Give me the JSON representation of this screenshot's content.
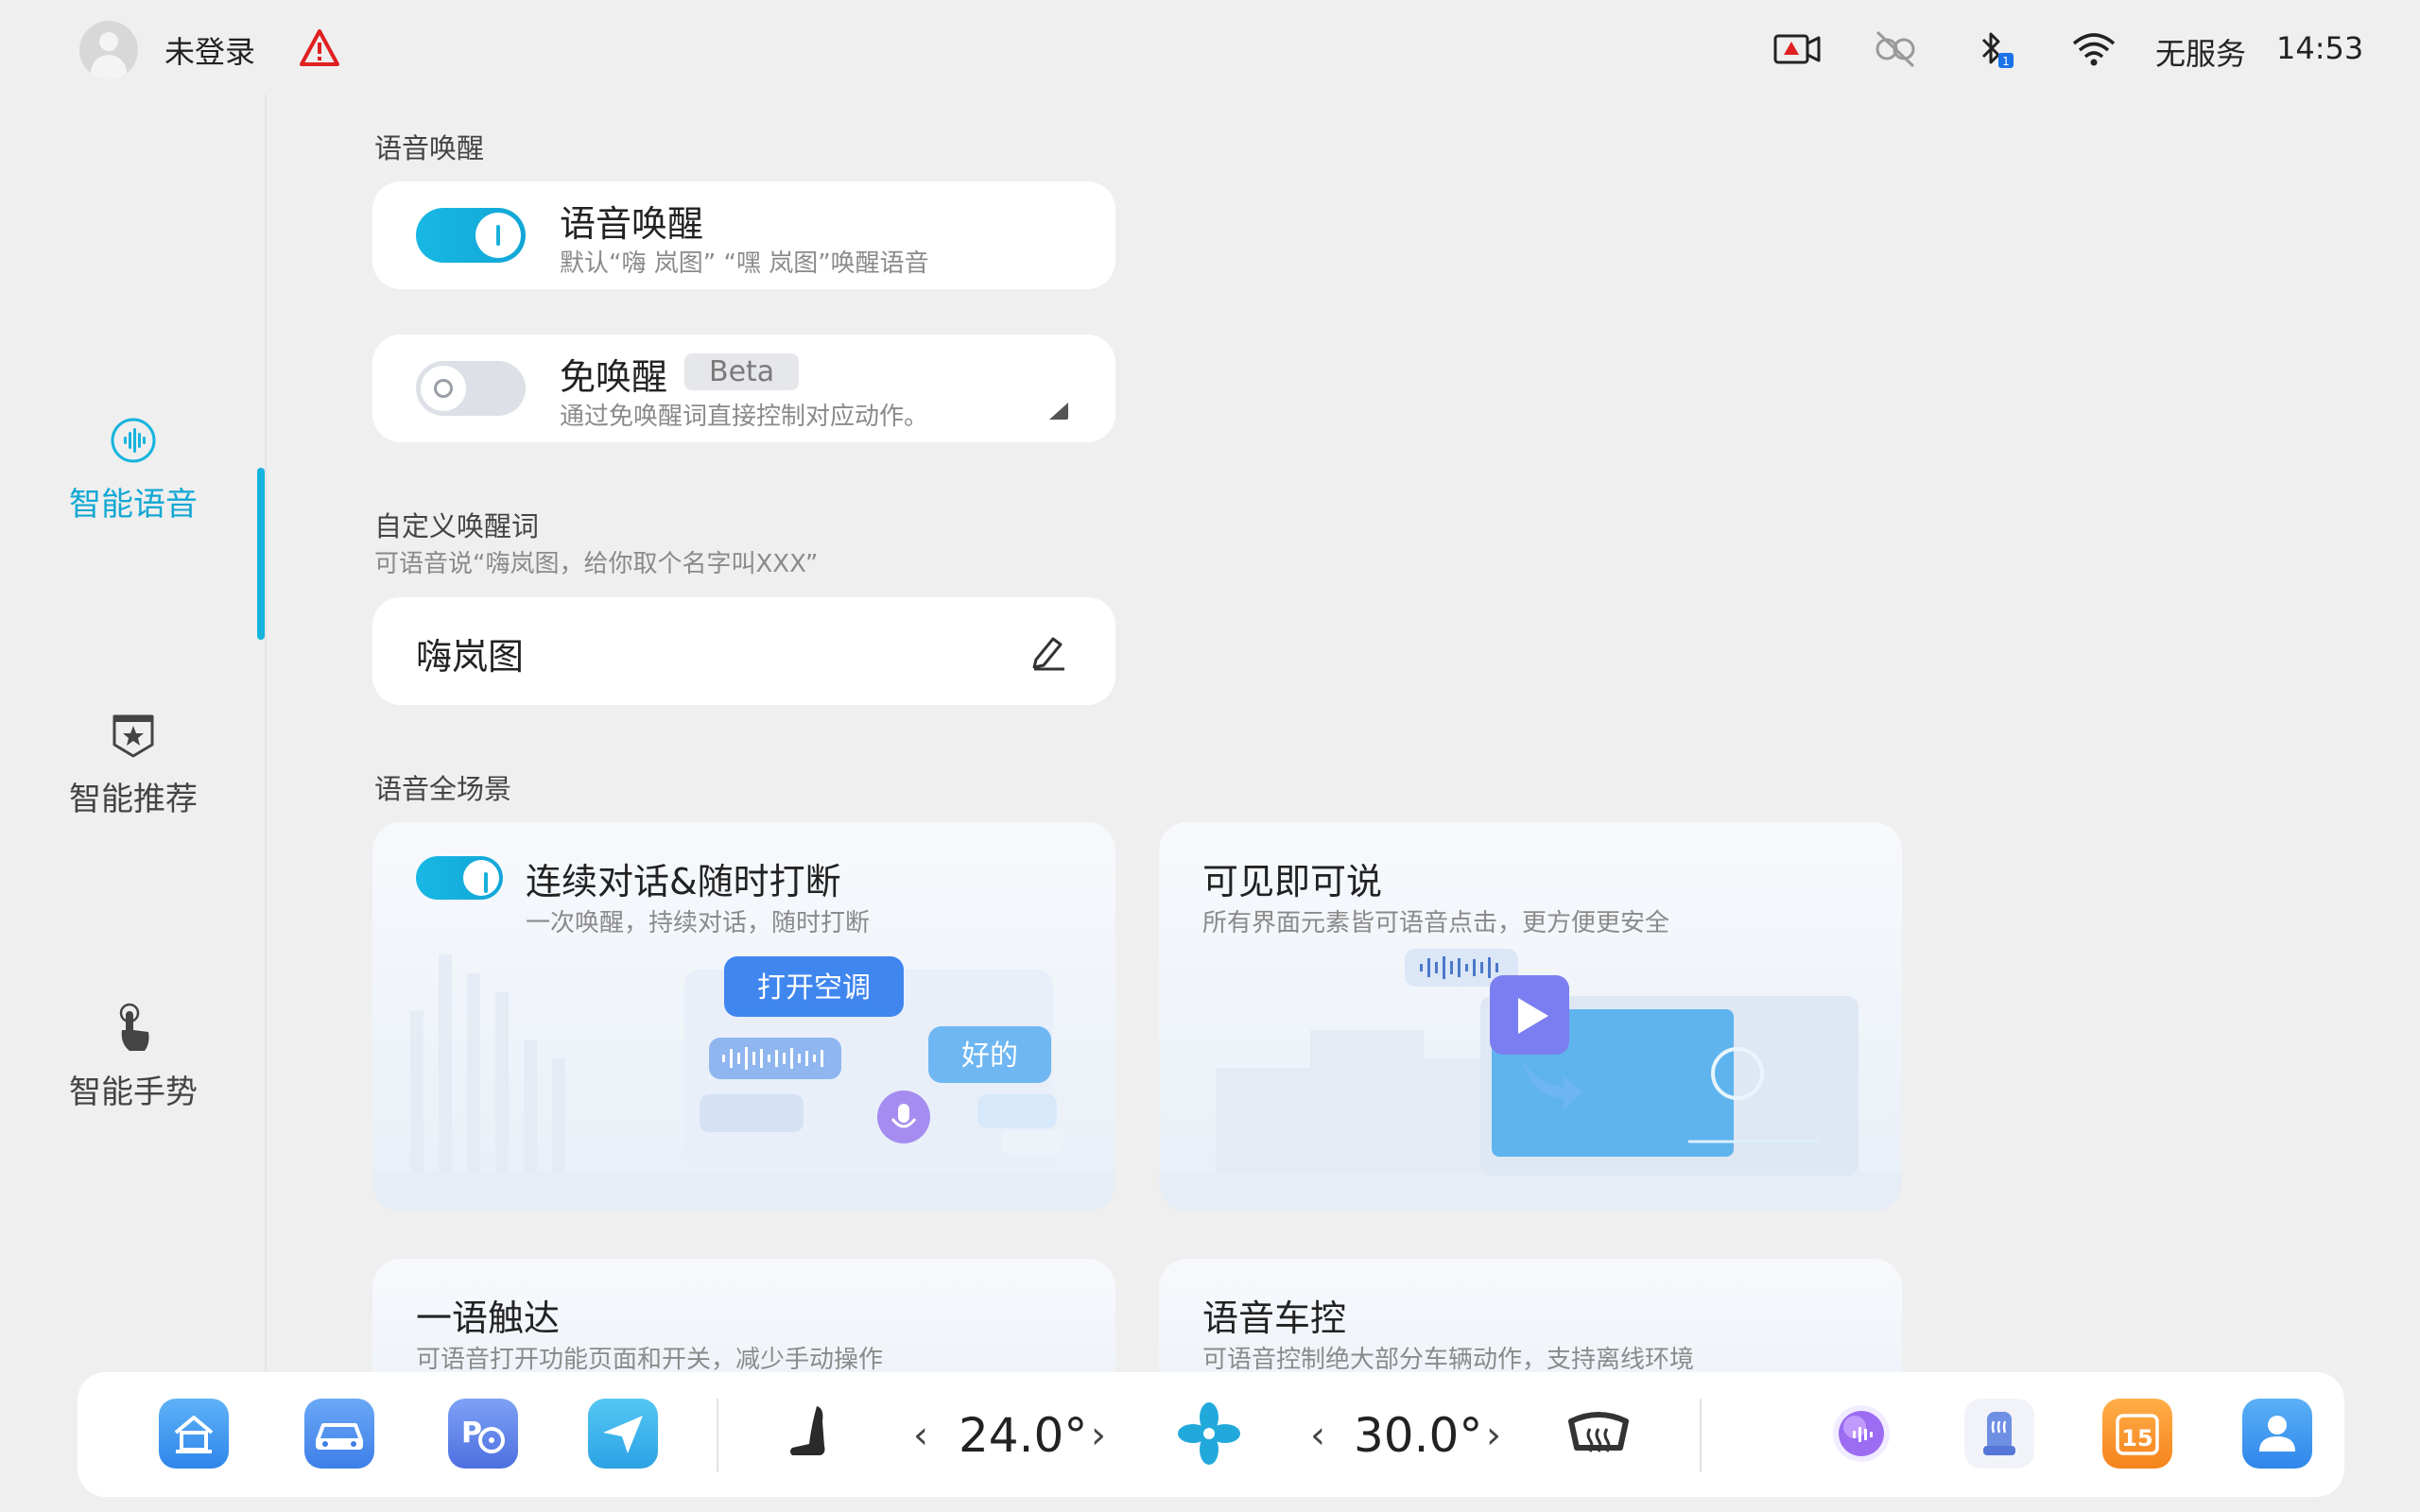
{
  "status_bar": {
    "login_status": "未登录",
    "service_status": "无服务",
    "time": "14:53",
    "icons": [
      "warning-icon",
      "dashcam-icon",
      "link-off-icon",
      "bluetooth-icon",
      "wifi-icon"
    ],
    "bluetooth_badge": "1"
  },
  "sidebar": {
    "items": [
      {
        "label": "智能语音",
        "icon": "voice-icon",
        "active": true
      },
      {
        "label": "智能推荐",
        "icon": "recommend-badge-icon",
        "active": false
      },
      {
        "label": "智能手势",
        "icon": "gesture-hand-icon",
        "active": false
      }
    ]
  },
  "wake_section": {
    "title": "语音唤醒",
    "wake_card": {
      "title": "语音唤醒",
      "desc": "默认“嗨 岚图” “嘿 岚图”唤醒语音",
      "enabled": true
    },
    "free_wake_card": {
      "title": "免唤醒",
      "badge": "Beta",
      "desc": "通过免唤醒词直接控制对应动作。",
      "enabled": false
    }
  },
  "custom_wake": {
    "title": "自定义唤醒词",
    "subtitle": "可语音说“嗨岚图，给你取个名字叫XXX”",
    "value": "嗨岚图"
  },
  "scene_section": {
    "title": "语音全场景",
    "cards": [
      {
        "title": "连续对话&随时打断",
        "desc": "一次唤醒，持续对话，随时打断",
        "enabled": true,
        "bubble_cmd": "打开空调",
        "bubble_reply": "好的"
      },
      {
        "title": "可见即可说",
        "desc": "所有界面元素皆可语音点击，更方便更安全"
      },
      {
        "title": "一语触达",
        "desc": "可语音打开功能页面和开关，减少手动操作"
      },
      {
        "title": "语音车控",
        "desc": "可语音控制绝大部分车辆动作，支持离线环境"
      }
    ]
  },
  "dock": {
    "left_temp": "24.0°",
    "right_temp": "30.0°",
    "apps": [
      "home-icon",
      "car-icon",
      "parking-icon",
      "navigation-icon",
      "seat-icon",
      "fan-icon",
      "rear-defrost-icon",
      "assistant-orb-icon",
      "seat-heat-icon",
      "calendar-icon",
      "user-profile-icon"
    ],
    "calendar_day": "15"
  },
  "colors": {
    "accent": "#16b4dd",
    "background": "#efefef",
    "card": "#ffffff"
  }
}
